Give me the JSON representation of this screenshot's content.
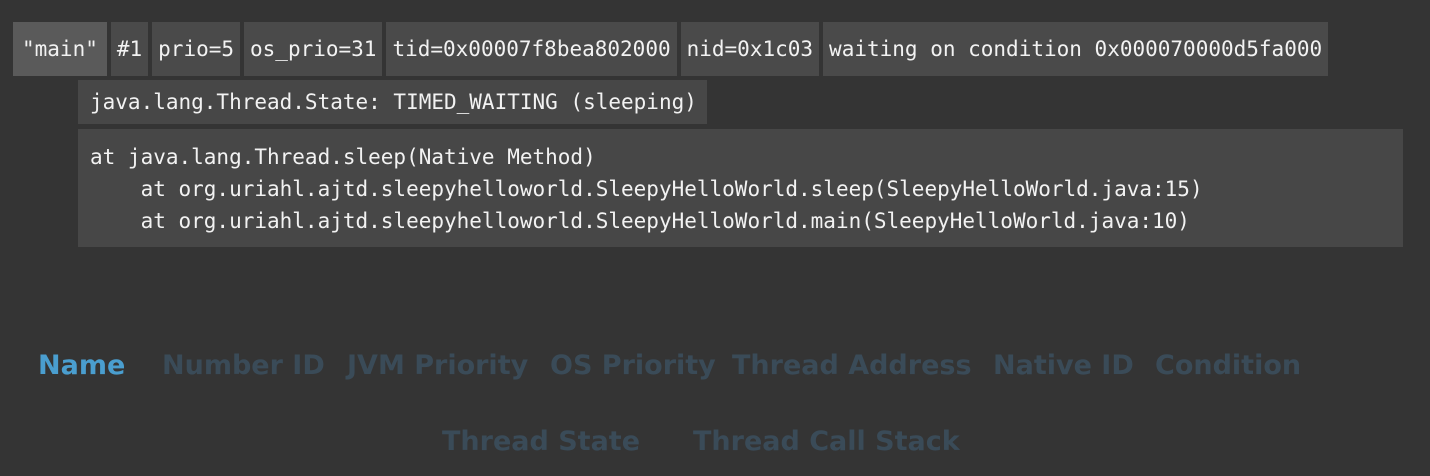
{
  "thread_header": {
    "name": "\"main\"",
    "number_id": "#1",
    "jvm_priority": "prio=5",
    "os_priority": "os_prio=31",
    "thread_address": "tid=0x00007f8bea802000",
    "native_id": "nid=0x1c03",
    "condition": "waiting on condition 0x000070000d5fa000"
  },
  "thread_state": "java.lang.Thread.State: TIMED_WAITING (sleeping)",
  "call_stack": [
    "at java.lang.Thread.sleep(Native Method)",
    "    at org.uriahl.ajtd.sleepyhelloworld.SleepyHelloWorld.sleep(SleepyHelloWorld.java:15)",
    "    at org.uriahl.ajtd.sleepyhelloworld.SleepyHelloWorld.main(SleepyHelloWorld.java:10)"
  ],
  "legend": {
    "name": "Name",
    "number_id": "Number ID",
    "jvm_priority": "JVM Priority",
    "os_priority": "OS Priority",
    "thread_address": "Thread Address",
    "native_id": "Native ID",
    "condition": "Condition",
    "thread_state": "Thread State",
    "thread_call_stack": "Thread Call Stack",
    "active": "name"
  },
  "colors": {
    "background": "#343434",
    "chip": "#4a4a4a",
    "highlight_chip": "#5a5a5a",
    "legend_active": "#4a9ecf",
    "legend_inactive": "#3a4b58"
  }
}
